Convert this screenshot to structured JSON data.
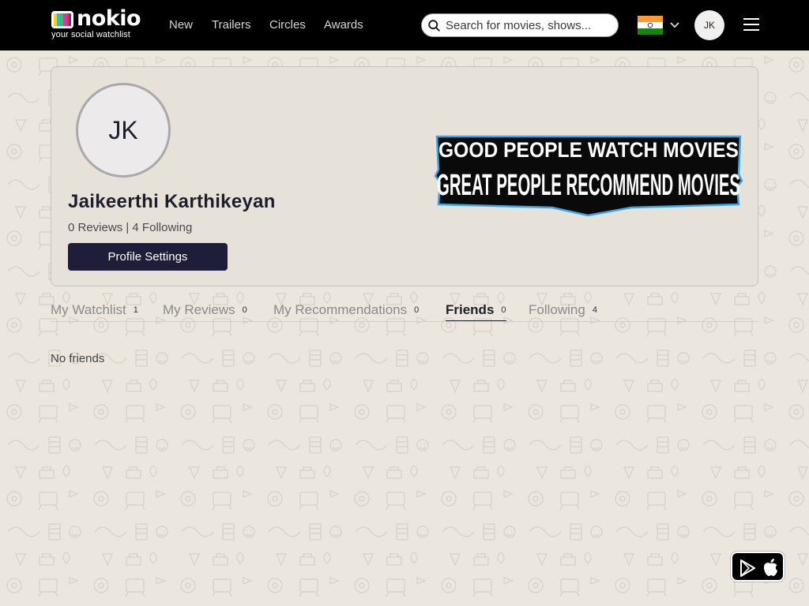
{
  "brand": {
    "name": "nokio",
    "tagline": "your social watchlist"
  },
  "nav": {
    "links": [
      "New",
      "Trailers",
      "Circles",
      "Awards"
    ],
    "search_placeholder": "Search for movies, shows...",
    "country_flag": "india-flag-icon",
    "avatar_initials": "JK"
  },
  "profile": {
    "initials": "JK",
    "name": "Jaikeerthi Karthikeyan",
    "stats": "0 Reviews | 4 Following",
    "settings_label": "Profile Settings",
    "banner_line1": "GOOD PEOPLE WATCH MOVIES",
    "banner_line2": "GREAT PEOPLE RECOMMEND MOVIES"
  },
  "tabs": [
    {
      "label": "My Watchlist",
      "count": "1"
    },
    {
      "label": "My Reviews",
      "count": "0"
    },
    {
      "label": "My Recommendations",
      "count": "0"
    },
    {
      "label": "Friends",
      "count": "0"
    },
    {
      "label": "Following",
      "count": "4"
    }
  ],
  "active_tab": "Friends",
  "content": {
    "empty_message": "No friends"
  },
  "colors": {
    "nav_bg": "#000000",
    "page_bg": "#ebe7df",
    "card_bg": "#e6e2da",
    "button_bg": "#1e1e3a",
    "flag_saffron": "#ff9933",
    "flag_green": "#138808"
  },
  "app_badge": {
    "icons": [
      "google-play-icon",
      "apple-icon"
    ]
  }
}
